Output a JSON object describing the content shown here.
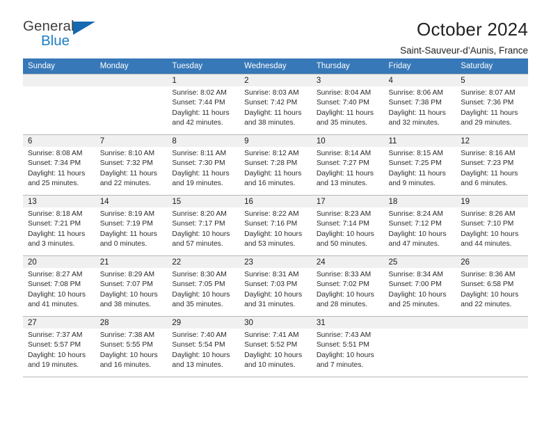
{
  "brand": {
    "name_part1": "General",
    "name_part2": "Blue",
    "triangle_color": "#1668b0",
    "blue_color": "#1c7cc4"
  },
  "header": {
    "title": "October 2024",
    "subtitle": "Saint-Sauveur-d’Aunis, France",
    "accent_color": "#3778b8"
  },
  "calendar": {
    "weekday_headers": [
      "Sunday",
      "Monday",
      "Tuesday",
      "Wednesday",
      "Thursday",
      "Friday",
      "Saturday"
    ],
    "weeks": [
      [
        {
          "day": "",
          "lines": []
        },
        {
          "day": "",
          "lines": []
        },
        {
          "day": "1",
          "lines": [
            "Sunrise: 8:02 AM",
            "Sunset: 7:44 PM",
            "Daylight: 11 hours",
            "and 42 minutes."
          ]
        },
        {
          "day": "2",
          "lines": [
            "Sunrise: 8:03 AM",
            "Sunset: 7:42 PM",
            "Daylight: 11 hours",
            "and 38 minutes."
          ]
        },
        {
          "day": "3",
          "lines": [
            "Sunrise: 8:04 AM",
            "Sunset: 7:40 PM",
            "Daylight: 11 hours",
            "and 35 minutes."
          ]
        },
        {
          "day": "4",
          "lines": [
            "Sunrise: 8:06 AM",
            "Sunset: 7:38 PM",
            "Daylight: 11 hours",
            "and 32 minutes."
          ]
        },
        {
          "day": "5",
          "lines": [
            "Sunrise: 8:07 AM",
            "Sunset: 7:36 PM",
            "Daylight: 11 hours",
            "and 29 minutes."
          ]
        }
      ],
      [
        {
          "day": "6",
          "lines": [
            "Sunrise: 8:08 AM",
            "Sunset: 7:34 PM",
            "Daylight: 11 hours",
            "and 25 minutes."
          ]
        },
        {
          "day": "7",
          "lines": [
            "Sunrise: 8:10 AM",
            "Sunset: 7:32 PM",
            "Daylight: 11 hours",
            "and 22 minutes."
          ]
        },
        {
          "day": "8",
          "lines": [
            "Sunrise: 8:11 AM",
            "Sunset: 7:30 PM",
            "Daylight: 11 hours",
            "and 19 minutes."
          ]
        },
        {
          "day": "9",
          "lines": [
            "Sunrise: 8:12 AM",
            "Sunset: 7:28 PM",
            "Daylight: 11 hours",
            "and 16 minutes."
          ]
        },
        {
          "day": "10",
          "lines": [
            "Sunrise: 8:14 AM",
            "Sunset: 7:27 PM",
            "Daylight: 11 hours",
            "and 13 minutes."
          ]
        },
        {
          "day": "11",
          "lines": [
            "Sunrise: 8:15 AM",
            "Sunset: 7:25 PM",
            "Daylight: 11 hours",
            "and 9 minutes."
          ]
        },
        {
          "day": "12",
          "lines": [
            "Sunrise: 8:16 AM",
            "Sunset: 7:23 PM",
            "Daylight: 11 hours",
            "and 6 minutes."
          ]
        }
      ],
      [
        {
          "day": "13",
          "lines": [
            "Sunrise: 8:18 AM",
            "Sunset: 7:21 PM",
            "Daylight: 11 hours",
            "and 3 minutes."
          ]
        },
        {
          "day": "14",
          "lines": [
            "Sunrise: 8:19 AM",
            "Sunset: 7:19 PM",
            "Daylight: 11 hours",
            "and 0 minutes."
          ]
        },
        {
          "day": "15",
          "lines": [
            "Sunrise: 8:20 AM",
            "Sunset: 7:17 PM",
            "Daylight: 10 hours",
            "and 57 minutes."
          ]
        },
        {
          "day": "16",
          "lines": [
            "Sunrise: 8:22 AM",
            "Sunset: 7:16 PM",
            "Daylight: 10 hours",
            "and 53 minutes."
          ]
        },
        {
          "day": "17",
          "lines": [
            "Sunrise: 8:23 AM",
            "Sunset: 7:14 PM",
            "Daylight: 10 hours",
            "and 50 minutes."
          ]
        },
        {
          "day": "18",
          "lines": [
            "Sunrise: 8:24 AM",
            "Sunset: 7:12 PM",
            "Daylight: 10 hours",
            "and 47 minutes."
          ]
        },
        {
          "day": "19",
          "lines": [
            "Sunrise: 8:26 AM",
            "Sunset: 7:10 PM",
            "Daylight: 10 hours",
            "and 44 minutes."
          ]
        }
      ],
      [
        {
          "day": "20",
          "lines": [
            "Sunrise: 8:27 AM",
            "Sunset: 7:08 PM",
            "Daylight: 10 hours",
            "and 41 minutes."
          ]
        },
        {
          "day": "21",
          "lines": [
            "Sunrise: 8:29 AM",
            "Sunset: 7:07 PM",
            "Daylight: 10 hours",
            "and 38 minutes."
          ]
        },
        {
          "day": "22",
          "lines": [
            "Sunrise: 8:30 AM",
            "Sunset: 7:05 PM",
            "Daylight: 10 hours",
            "and 35 minutes."
          ]
        },
        {
          "day": "23",
          "lines": [
            "Sunrise: 8:31 AM",
            "Sunset: 7:03 PM",
            "Daylight: 10 hours",
            "and 31 minutes."
          ]
        },
        {
          "day": "24",
          "lines": [
            "Sunrise: 8:33 AM",
            "Sunset: 7:02 PM",
            "Daylight: 10 hours",
            "and 28 minutes."
          ]
        },
        {
          "day": "25",
          "lines": [
            "Sunrise: 8:34 AM",
            "Sunset: 7:00 PM",
            "Daylight: 10 hours",
            "and 25 minutes."
          ]
        },
        {
          "day": "26",
          "lines": [
            "Sunrise: 8:36 AM",
            "Sunset: 6:58 PM",
            "Daylight: 10 hours",
            "and 22 minutes."
          ]
        }
      ],
      [
        {
          "day": "27",
          "lines": [
            "Sunrise: 7:37 AM",
            "Sunset: 5:57 PM",
            "Daylight: 10 hours",
            "and 19 minutes."
          ]
        },
        {
          "day": "28",
          "lines": [
            "Sunrise: 7:38 AM",
            "Sunset: 5:55 PM",
            "Daylight: 10 hours",
            "and 16 minutes."
          ]
        },
        {
          "day": "29",
          "lines": [
            "Sunrise: 7:40 AM",
            "Sunset: 5:54 PM",
            "Daylight: 10 hours",
            "and 13 minutes."
          ]
        },
        {
          "day": "30",
          "lines": [
            "Sunrise: 7:41 AM",
            "Sunset: 5:52 PM",
            "Daylight: 10 hours",
            "and 10 minutes."
          ]
        },
        {
          "day": "31",
          "lines": [
            "Sunrise: 7:43 AM",
            "Sunset: 5:51 PM",
            "Daylight: 10 hours",
            "and 7 minutes."
          ]
        },
        {
          "day": "",
          "lines": []
        },
        {
          "day": "",
          "lines": []
        }
      ]
    ]
  }
}
